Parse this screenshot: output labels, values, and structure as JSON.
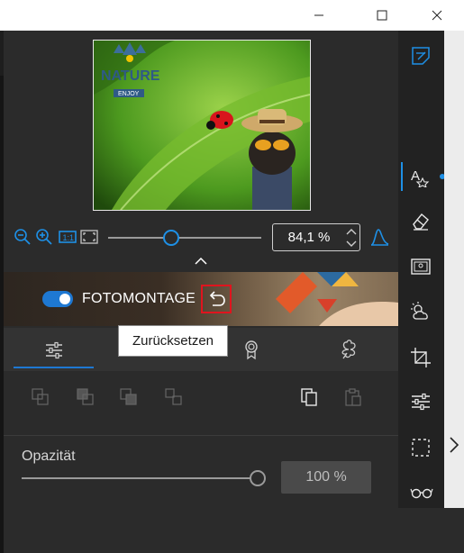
{
  "window": {
    "controls": [
      "minimize-icon",
      "maximize-icon",
      "close-icon"
    ]
  },
  "zoom": {
    "value": "84,1 %",
    "slider_level": 0.41,
    "icons": [
      "zoom-out-icon",
      "zoom-in-icon",
      "actual-size-icon",
      "fit-to-window-icon",
      "histogram-icon"
    ]
  },
  "banner": {
    "title": "FOTOMONTAGE",
    "toggle_on": true
  },
  "tooltip": {
    "text": "Zurücksetzen"
  },
  "preview": {
    "logo_line1": "NATURE",
    "logo_line2": "ENJOY"
  },
  "tabs": [
    "adjustments-tab-icon",
    "award-tab-icon",
    "clover-tab-icon"
  ],
  "layer_tools": [
    "arrange-icon-1",
    "arrange-icon-2",
    "arrange-icon-3",
    "arrange-icon-4",
    "copy-icon",
    "paste-icon"
  ],
  "opacity": {
    "label": "Opazität",
    "value": "100 %",
    "level": 1.0
  },
  "right_toolbar": [
    "notes-icon",
    "text-effects-icon",
    "eraser-icon",
    "image-frame-icon",
    "weather-icon",
    "crop-icon",
    "sliders-icon",
    "selection-icon",
    "glasses-icon"
  ],
  "colors": {
    "accent": "#1e90e6",
    "highlight": "#e0141e",
    "panel": "#2b2b2b"
  }
}
